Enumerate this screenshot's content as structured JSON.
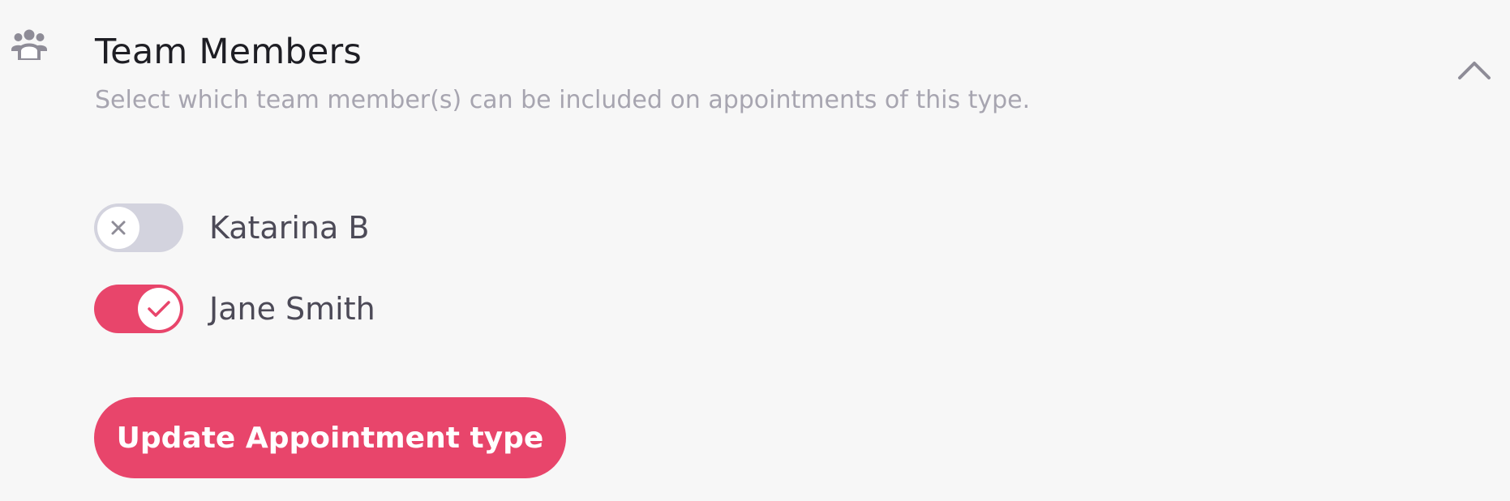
{
  "section": {
    "icon": "team-people-icon",
    "title": "Team Members",
    "description": "Select which team member(s) can be included on appointments of this type.",
    "collapse_icon": "chevron-up-icon"
  },
  "members": [
    {
      "name": "Katarina B",
      "included": false,
      "toggle_icon": "x-icon"
    },
    {
      "name": "Jane Smith",
      "included": true,
      "toggle_icon": "check-icon"
    }
  ],
  "actions": {
    "update_label": "Update Appointment type"
  },
  "colors": {
    "accent": "#e8456b",
    "toggle_off": "#d3d3de",
    "title_text": "#1e1e24",
    "muted_text": "#a7a5b0",
    "body_text": "#4c4a57",
    "background": "#f7f7f7"
  }
}
